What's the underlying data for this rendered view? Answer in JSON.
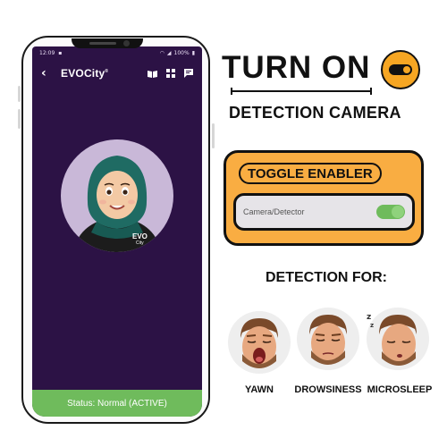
{
  "phone": {
    "status_bar": {
      "time": "12:09",
      "battery": "100%"
    },
    "app_bar": {
      "brand": "EVOCity",
      "brand_suffix": "®"
    },
    "avatar": {
      "shirt_text": "EVO",
      "shirt_subtext": "City"
    },
    "footer_status": "Status: Normal (ACTIVE)",
    "icons": [
      "back-icon",
      "book-icon",
      "grid-icon",
      "message-icon"
    ]
  },
  "headline": {
    "line1": "TURN ON",
    "line2": "DETECTION CAMERA"
  },
  "enabler": {
    "title": "TOGGLE ENABLER",
    "setting_label": "Camera/Detector",
    "setting_on": true
  },
  "detection": {
    "heading": "DETECTION FOR:",
    "items": [
      {
        "label": "YAWN"
      },
      {
        "label": "DROWSINESS"
      },
      {
        "label": "MICROSLEEP"
      }
    ]
  },
  "colors": {
    "app_background": "#2c1245",
    "accent_orange": "#f9ad42",
    "status_green": "#6fbb5c"
  }
}
